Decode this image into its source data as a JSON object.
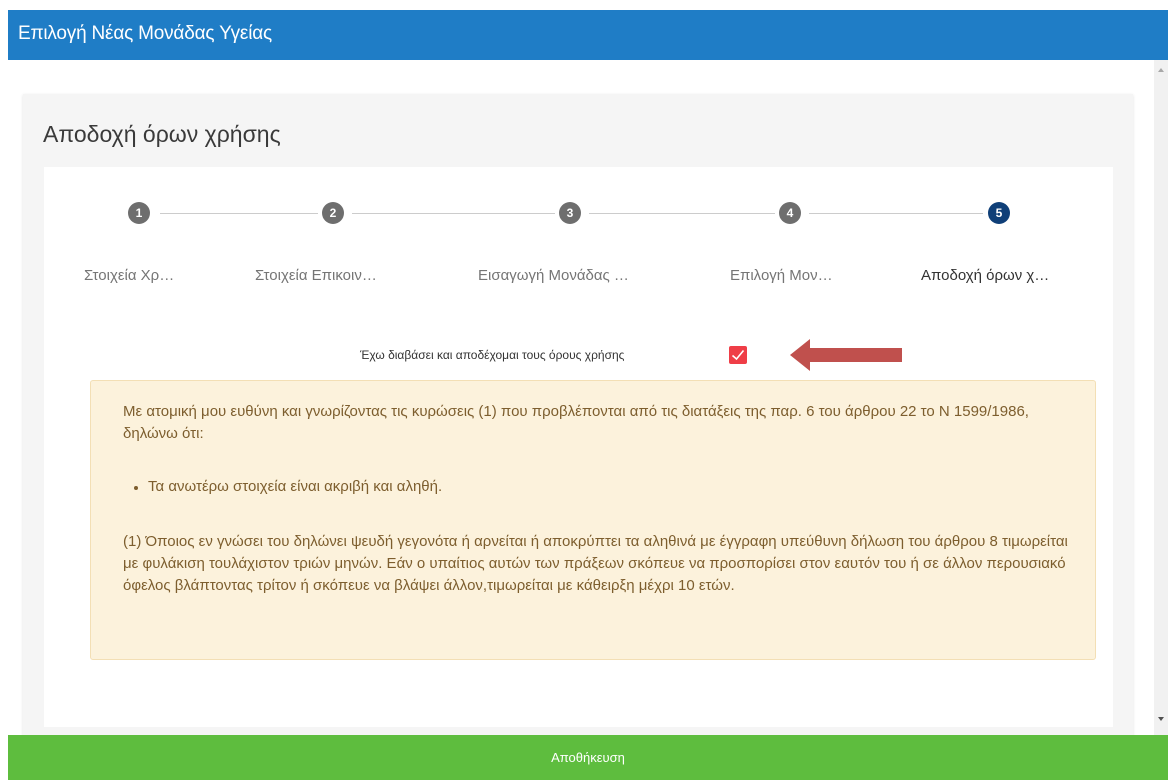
{
  "header": {
    "title": "Επιλογή Νέας Μονάδας Υγείας"
  },
  "card": {
    "title": "Αποδοχή όρων χρήσης"
  },
  "steps": [
    {
      "number": "1",
      "label": "Στοιχεία Χρ…",
      "active": false
    },
    {
      "number": "2",
      "label": "Στοιχεία Επικοιν…",
      "active": false
    },
    {
      "number": "3",
      "label": "Εισαγωγή Μονάδας …",
      "active": false
    },
    {
      "number": "4",
      "label": "Επιλογή Μον…",
      "active": false
    },
    {
      "number": "5",
      "label": "Αποδοχή όρων χ…",
      "active": true
    }
  ],
  "accept": {
    "label": "Έχω διαβάσει και αποδέχομαι τους όρους χρήσης",
    "checked": true
  },
  "terms": {
    "intro": "Με ατομική μου ευθύνη και γνωρίζοντας τις κυρώσεις (1) που προβλέπονται από τις διατάξεις της παρ. 6 του άρθρου 22 το Ν 1599/1986, δηλώνω ότι:",
    "bullet": "Τα ανωτέρω στοιχεία είναι ακριβή και αληθή.",
    "note": "(1) Όποιος εν γνώσει του δηλώνει ψευδή γεγονότα ή αρνείται ή αποκρύπτει τα αληθινά με έγγραφη υπεύθυνη δήλωση του άρθρου 8 τιμωρείται με φυλάκιση τουλάχιστον τριών μηνών. Εάν ο υπαίτιος αυτών των πράξεων σκόπευε να προσπορίσει στον εαυτόν του ή σε άλλον περουσιακό όφελος βλάπτοντας τρίτον ή σκόπευε να βλάψει άλλον,τιμωρείται με κάθειρξη μέχρι 10 ετών."
  },
  "footer": {
    "save_label": "Αποθήκευση"
  },
  "colors": {
    "header": "#1f7dc6",
    "active_step": "#0f3f78",
    "checkbox": "#ef3e47",
    "save": "#5ebd3e",
    "arrow": "#c0504d"
  }
}
